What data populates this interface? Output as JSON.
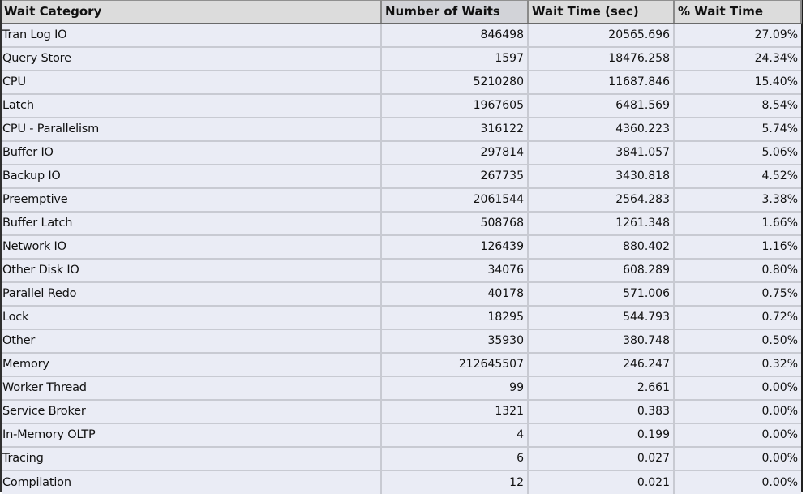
{
  "table": {
    "headers": {
      "category": "Wait Category",
      "waits": "Number of Waits",
      "time": "Wait Time (sec)",
      "pct": "% Wait Time"
    },
    "rows": [
      {
        "category": "Tran Log IO",
        "waits": "846498",
        "time": "20565.696",
        "pct": "27.09%"
      },
      {
        "category": "Query Store",
        "waits": "1597",
        "time": "18476.258",
        "pct": "24.34%"
      },
      {
        "category": "CPU",
        "waits": "5210280",
        "time": "11687.846",
        "pct": "15.40%"
      },
      {
        "category": "Latch",
        "waits": "1967605",
        "time": "6481.569",
        "pct": "8.54%"
      },
      {
        "category": "CPU - Parallelism",
        "waits": "316122",
        "time": "4360.223",
        "pct": "5.74%"
      },
      {
        "category": "Buffer IO",
        "waits": "297814",
        "time": "3841.057",
        "pct": "5.06%"
      },
      {
        "category": "Backup IO",
        "waits": "267735",
        "time": "3430.818",
        "pct": "4.52%"
      },
      {
        "category": "Preemptive",
        "waits": "2061544",
        "time": "2564.283",
        "pct": "3.38%"
      },
      {
        "category": "Buffer Latch",
        "waits": "508768",
        "time": "1261.348",
        "pct": "1.66%"
      },
      {
        "category": "Network IO",
        "waits": "126439",
        "time": "880.402",
        "pct": "1.16%"
      },
      {
        "category": "Other Disk IO",
        "waits": "34076",
        "time": "608.289",
        "pct": "0.80%"
      },
      {
        "category": "Parallel Redo",
        "waits": "40178",
        "time": "571.006",
        "pct": "0.75%"
      },
      {
        "category": "Lock",
        "waits": "18295",
        "time": "544.793",
        "pct": "0.72%"
      },
      {
        "category": "Other",
        "waits": "35930",
        "time": "380.748",
        "pct": "0.50%"
      },
      {
        "category": "Memory",
        "waits": "212645507",
        "time": "246.247",
        "pct": "0.32%"
      },
      {
        "category": "Worker Thread",
        "waits": "99",
        "time": "2.661",
        "pct": "0.00%"
      },
      {
        "category": "Service Broker",
        "waits": "1321",
        "time": "0.383",
        "pct": "0.00%"
      },
      {
        "category": "In-Memory OLTP",
        "waits": "4",
        "time": "0.199",
        "pct": "0.00%"
      },
      {
        "category": "Tracing",
        "waits": "6",
        "time": "0.027",
        "pct": "0.00%"
      },
      {
        "category": "Compilation",
        "waits": "12",
        "time": "0.021",
        "pct": "0.00%"
      }
    ]
  },
  "colors": {
    "header_bg": "#dcdcdc",
    "row_bg": "#eaecf5",
    "grid_line": "#c8cad2",
    "flag_green": "#1a8a1a"
  }
}
